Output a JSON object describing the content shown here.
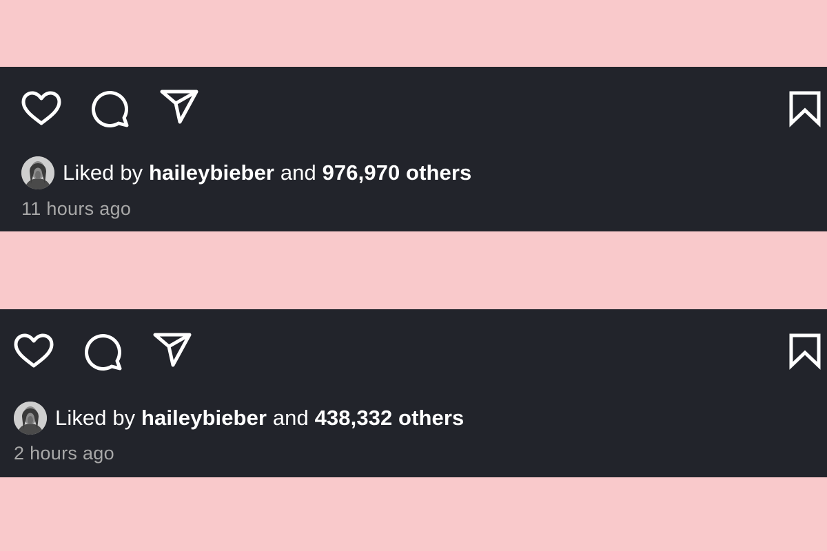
{
  "posts": [
    {
      "liked_prefix": "Liked by",
      "liked_user": "haileybieber",
      "liked_connector": "and",
      "liked_count": "976,970 others",
      "time_ago": "11 hours ago"
    },
    {
      "liked_prefix": "Liked by",
      "liked_user": "haileybieber",
      "liked_connector": "and",
      "liked_count": "438,332 others",
      "time_ago": "2 hours ago"
    }
  ],
  "icons": {
    "like": "heart-icon",
    "comment": "comment-icon",
    "share": "paper-plane-icon",
    "save": "bookmark-icon"
  },
  "colors": {
    "page_background": "#f9c9cb",
    "post_background": "#22242b",
    "text_primary": "#ffffff",
    "text_secondary": "#a8a8a8"
  }
}
